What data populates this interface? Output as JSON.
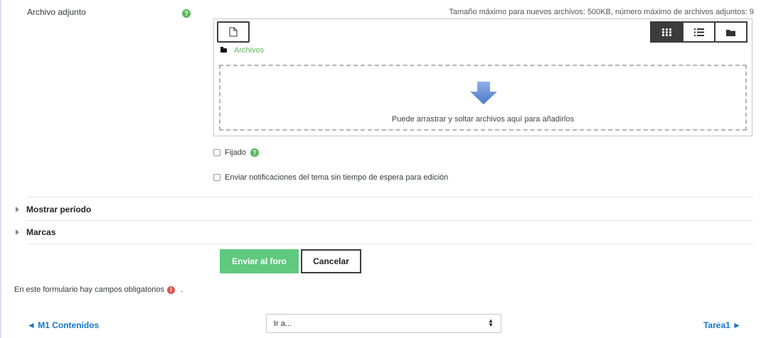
{
  "attachment": {
    "label": "Archivo adjunto",
    "help": "?",
    "max_info": "Tamaño máximo para nuevos archivos: 500KB, número máximo de archivos adjuntos: 9",
    "path_label": "Archivos",
    "drop_text": "Puede arrastrar y soltar archivos aquí para añadirlos",
    "add_file_icon": "file-icon",
    "views": [
      "grid-view-icon",
      "list-view-icon",
      "folder-view-icon"
    ],
    "active_view": "grid-view-icon"
  },
  "options": {
    "pinned_label": "Fijado",
    "pinned_help": "?",
    "notify_label": "Enviar notificaciones del tema sin tiempo de espera para edición"
  },
  "sections": {
    "show_period": "Mostrar período",
    "tags": "Marcas"
  },
  "actions": {
    "submit_label": "Enviar al foro",
    "cancel_label": "Cancelar"
  },
  "required_note": {
    "text": "En este formulario hay campos obligatorios",
    "icon": "!",
    "trail": "."
  },
  "navigation": {
    "prev_label": "◄ M1 Contenidos",
    "jump_placeholder": "Ir a...",
    "next_label": "Tarea1 ►"
  },
  "colors": {
    "accent_green": "#5fc97e",
    "link_blue": "#1177d1",
    "required_red": "#d9534f"
  }
}
